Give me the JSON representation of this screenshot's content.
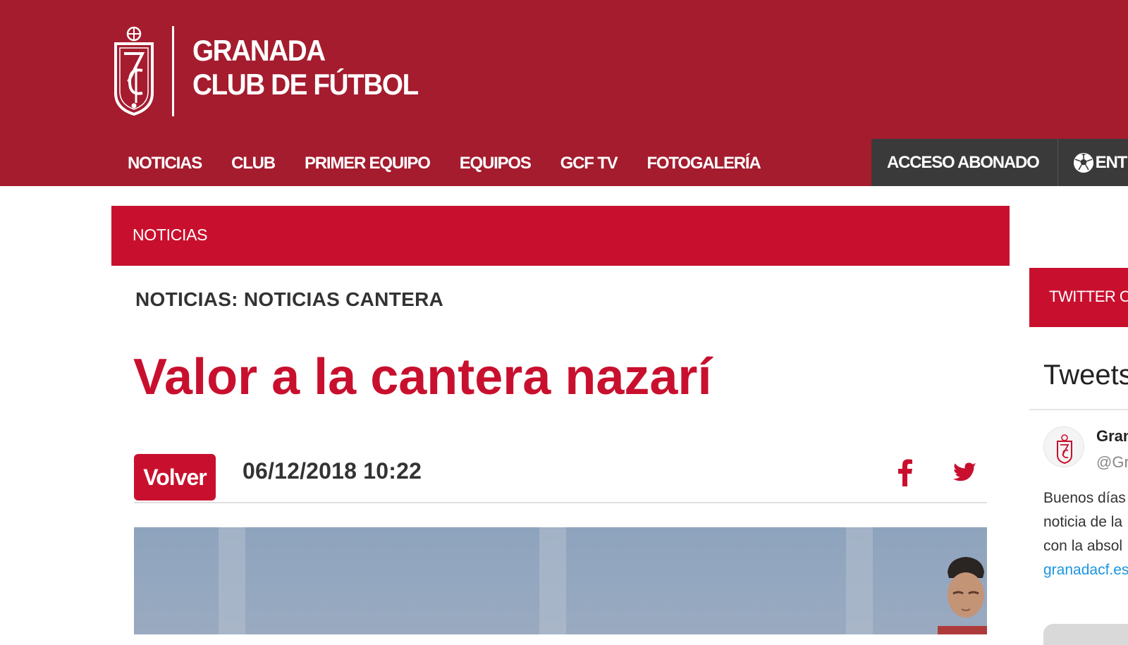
{
  "header": {
    "brand_line1": "GRANADA",
    "brand_line2": "CLUB DE FÚTBOL",
    "nav": [
      {
        "label": "NOTICIAS"
      },
      {
        "label": "CLUB"
      },
      {
        "label": "PRIMER EQUIPO"
      },
      {
        "label": "EQUIPOS"
      },
      {
        "label": "GCF TV"
      },
      {
        "label": "FOTOGALERÍA"
      }
    ],
    "acceso_label": "ACCESO ABONADO",
    "entradas_label": "ENT",
    "entradas_icon": "soccer-ball-icon"
  },
  "section": {
    "label": "NOTICIAS"
  },
  "article": {
    "breadcrumb": "NOTICIAS: NOTICIAS CANTERA",
    "title": "Valor a la cantera nazarí",
    "back_label": "Volver",
    "date": "06/12/2018 10:22",
    "share_icons": [
      "facebook-icon",
      "twitter-icon"
    ]
  },
  "sidebar": {
    "twitter_bar_label": "TWITTER O",
    "tweets_title": "Tweets",
    "tweet": {
      "name": "Gran",
      "handle": "@Gr",
      "lines": [
        "Buenos días",
        "noticia de la",
        "con la absol"
      ],
      "link": "granadacf.es"
    }
  },
  "colors": {
    "header_bg": "#a41c2e",
    "accent_red": "#c8102e",
    "account_bar": "#3a3a3a",
    "link_blue": "#1b95e0"
  }
}
